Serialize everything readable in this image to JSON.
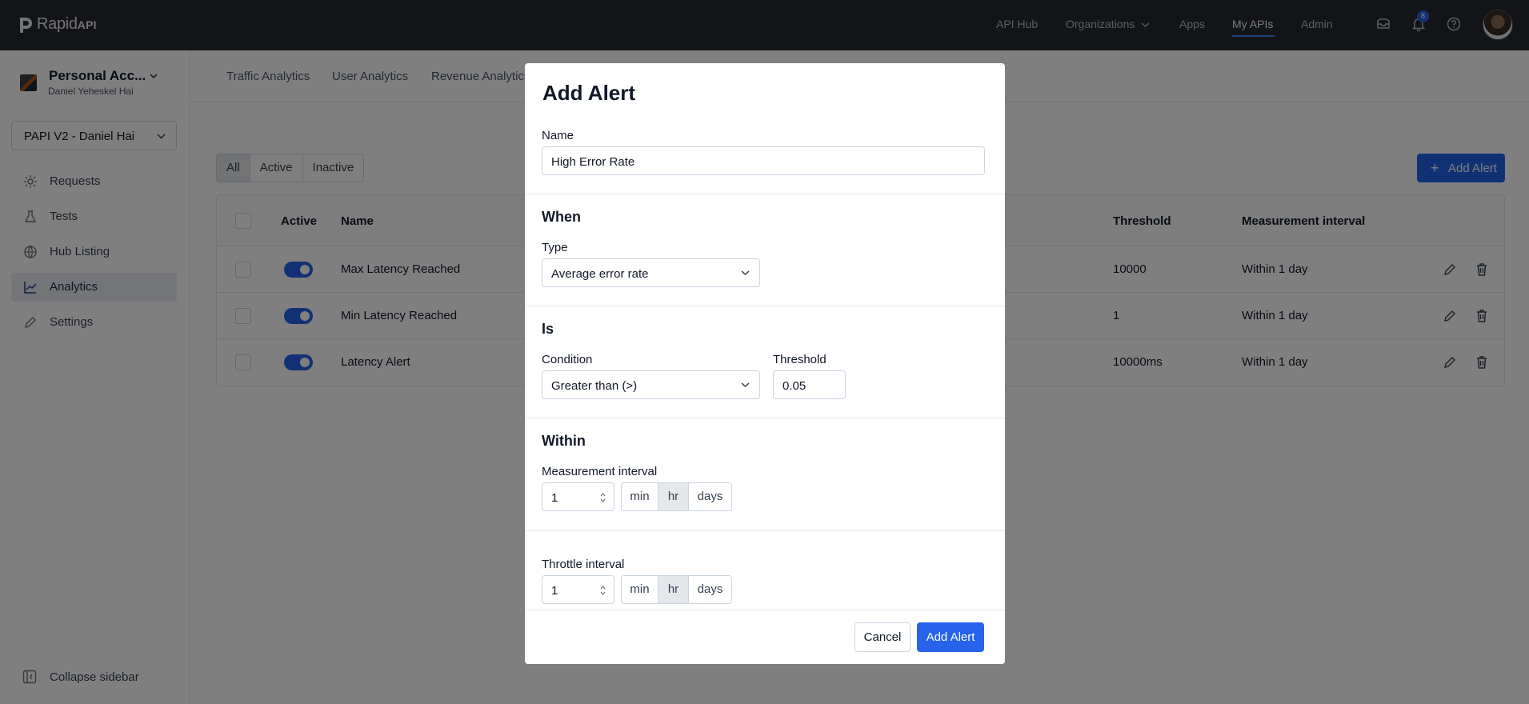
{
  "topbar": {
    "logo_text": "Rapid",
    "logo_suffix": "API",
    "nav": [
      "API Hub",
      "Organizations",
      "Apps",
      "My APIs",
      "Admin"
    ],
    "active_nav": "My APIs",
    "notification_count": "8"
  },
  "sidebar": {
    "account_name": "Personal Acc...",
    "account_user": "Daniel Yeheskel Hai",
    "project": "PAPI V2 - Daniel Hai",
    "items": [
      {
        "label": "Requests",
        "icon": "requests-icon"
      },
      {
        "label": "Tests",
        "icon": "flask-icon"
      },
      {
        "label": "Hub Listing",
        "icon": "globe-icon"
      },
      {
        "label": "Analytics",
        "icon": "chart-icon"
      },
      {
        "label": "Settings",
        "icon": "pencil-icon"
      }
    ],
    "active_item": "Analytics",
    "collapse_label": "Collapse sidebar"
  },
  "subnav": {
    "tabs": [
      "Traffic Analytics",
      "User Analytics",
      "Revenue Analytics"
    ]
  },
  "filters": {
    "options": [
      "All",
      "Active",
      "Inactive"
    ],
    "selected": "All"
  },
  "add_alert_button": "Add Alert",
  "table": {
    "headers": {
      "active": "Active",
      "name": "Name",
      "threshold": "Threshold",
      "interval": "Measurement interval"
    },
    "rows": [
      {
        "name": "Max Latency Reached",
        "threshold": "10000",
        "interval": "Within 1 day",
        "active": true
      },
      {
        "name": "Min Latency Reached",
        "threshold": "1",
        "interval": "Within 1 day",
        "active": true
      },
      {
        "name": "Latency Alert",
        "threshold": "10000ms",
        "interval": "Within 1 day",
        "active": true
      }
    ]
  },
  "modal": {
    "title": "Add Alert",
    "name_label": "Name",
    "name_value": "High Error Rate",
    "when_section": "When",
    "type_label": "Type",
    "type_value": "Average error rate",
    "is_section": "Is",
    "condition_label": "Condition",
    "condition_value": "Greater than (>)",
    "threshold_label": "Threshold",
    "threshold_value": "0.05",
    "within_section": "Within",
    "measurement_label": "Measurement interval",
    "measurement_value": "1",
    "throttle_label": "Throttle interval",
    "throttle_value": "1",
    "units": [
      "min",
      "hr",
      "days"
    ],
    "selected_unit": "hr",
    "cancel": "Cancel",
    "submit": "Add Alert"
  },
  "colors": {
    "primary": "#2563eb",
    "topbar": "#27292e"
  }
}
